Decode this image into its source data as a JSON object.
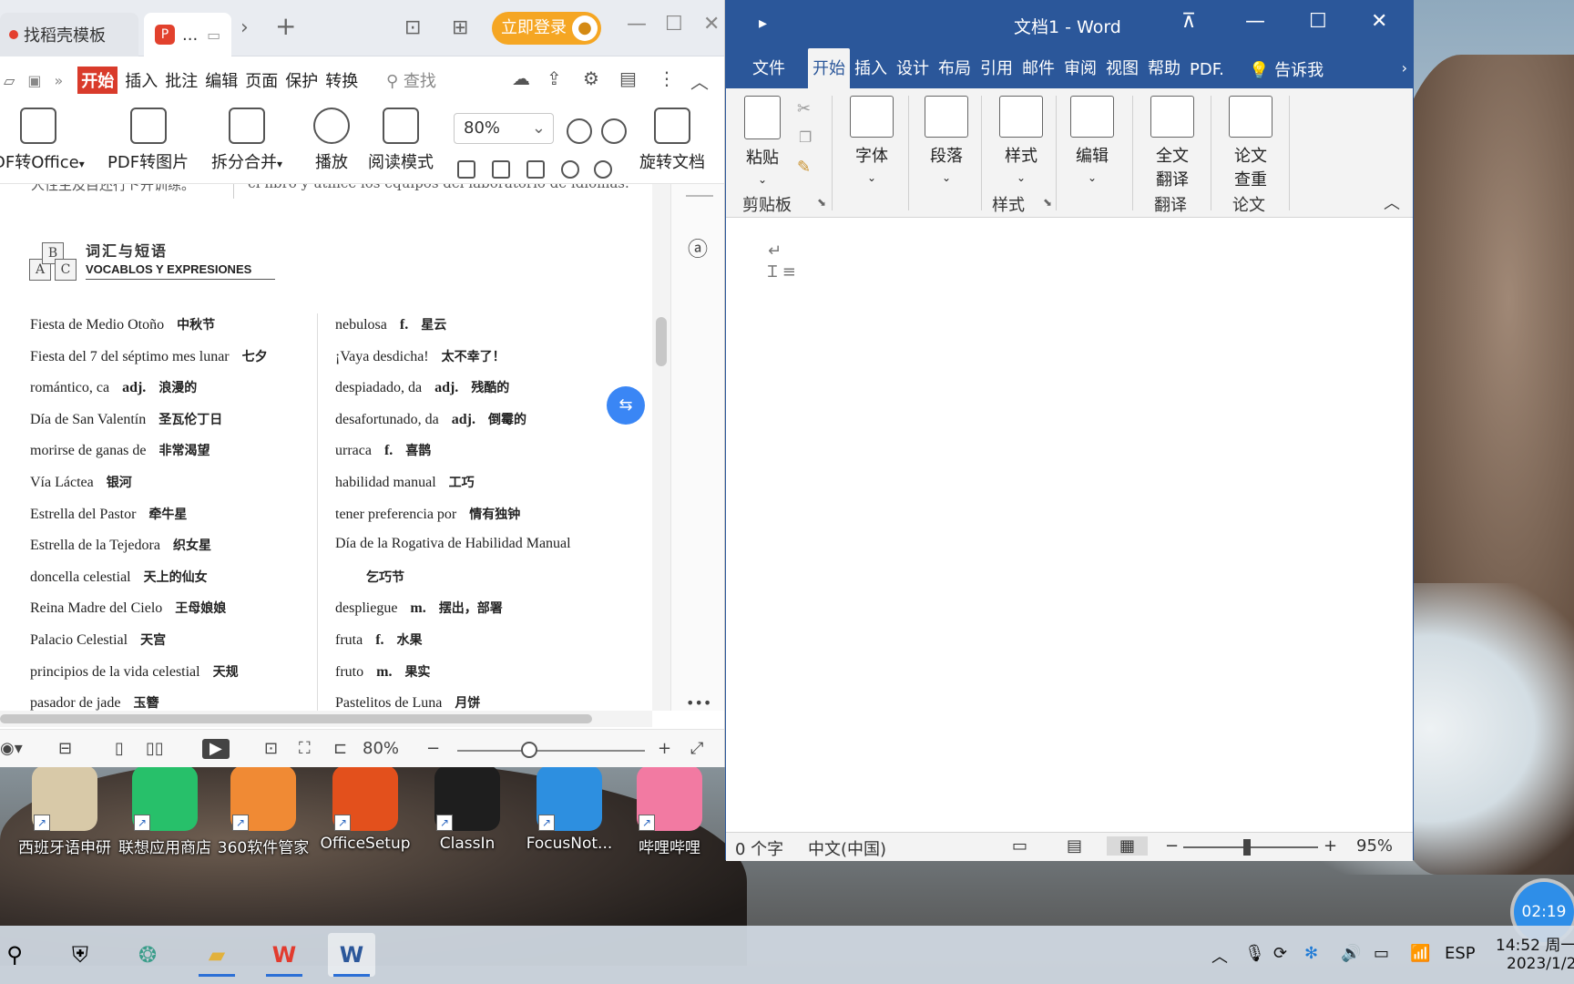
{
  "wps": {
    "tabs": [
      {
        "label": "找稻壳模板"
      },
      {
        "label": "..."
      }
    ],
    "login_label": "立即登录",
    "menu": {
      "active": "开始",
      "items": [
        "插入",
        "批注",
        "编辑",
        "页面",
        "保护",
        "转换"
      ],
      "search_placeholder": "查找"
    },
    "ribbon": {
      "pdf_to_office": "DF转Office",
      "pdf_to_image": "PDF转图片",
      "split_merge": "拆分合并",
      "play": "播放",
      "read_mode": "阅读模式",
      "zoom": "80%",
      "rotate": "旋转文档"
    },
    "page_top_text_left": "人性主及目还行ト开训练。",
    "page_top_text_right": "el libro y utilice los equipos del laboratorio de idiomas.",
    "vocab_title_cn": "词汇与短语",
    "vocab_title_es": "VOCABLOS Y EXPRESIONES",
    "logo_letters": [
      "A",
      "B",
      "C"
    ],
    "vocab_left": [
      {
        "es": "Fiesta de Medio Otoño",
        "pos": "",
        "zh": "中秋节"
      },
      {
        "es": "Fiesta del 7 del séptimo mes lunar",
        "pos": "",
        "zh": "七夕"
      },
      {
        "es": "romántico, ca",
        "pos": "adj.",
        "zh": "浪漫的"
      },
      {
        "es": "Día de San Valentín",
        "pos": "",
        "zh": "圣瓦伦丁日"
      },
      {
        "es": "morirse de ganas de",
        "pos": "",
        "zh": "非常渴望"
      },
      {
        "es": "Vía Láctea",
        "pos": "",
        "zh": "银河"
      },
      {
        "es": "Estrella del Pastor",
        "pos": "",
        "zh": "牵牛星"
      },
      {
        "es": "Estrella de la Tejedora",
        "pos": "",
        "zh": "织女星"
      },
      {
        "es": "doncella celestial",
        "pos": "",
        "zh": "天上的仙女"
      },
      {
        "es": "Reina Madre del Cielo",
        "pos": "",
        "zh": "王母娘娘"
      },
      {
        "es": "Palacio Celestial",
        "pos": "",
        "zh": "天宫"
      },
      {
        "es": "principios de la vida celestial",
        "pos": "",
        "zh": "天规"
      },
      {
        "es": "pasador de jade",
        "pos": "",
        "zh": "玉簪"
      }
    ],
    "vocab_right": [
      {
        "es": "nebulosa",
        "pos": "f.",
        "zh": "星云"
      },
      {
        "es": "¡Vaya desdicha!",
        "pos": "",
        "zh": "太不幸了！"
      },
      {
        "es": "despiadado, da",
        "pos": "adj.",
        "zh": "残酷的"
      },
      {
        "es": "desafortunado, da",
        "pos": "adj.",
        "zh": "倒霉的"
      },
      {
        "es": "urraca",
        "pos": "f.",
        "zh": "喜鹊"
      },
      {
        "es": "habilidad manual",
        "pos": "",
        "zh": "工巧"
      },
      {
        "es": "tener preferencia por",
        "pos": "",
        "zh": "情有独钟"
      },
      {
        "es": "Día de la Rogativa de Habilidad Manual",
        "pos": "",
        "zh": ""
      },
      {
        "es": "",
        "pos": "",
        "zh": "乞巧节"
      },
      {
        "es": "despliegue",
        "pos": "m.",
        "zh": "摆出，部署"
      },
      {
        "es": "fruta",
        "pos": "f.",
        "zh": "水果"
      },
      {
        "es": "fruto",
        "pos": "m.",
        "zh": "果实"
      },
      {
        "es": "Pastelitos de Luna",
        "pos": "",
        "zh": "月饼"
      }
    ],
    "status_zoom": "80%",
    "sidebar_more": "•••"
  },
  "word": {
    "title": "文档1  -  Word",
    "tabs": [
      "文件",
      "开始",
      "插入",
      "设计",
      "布局",
      "引用",
      "邮件",
      "审阅",
      "视图",
      "帮助",
      "PDF."
    ],
    "tell_me": "告诉我",
    "ribbon": {
      "paste": "粘贴",
      "font": "字体",
      "paragraph": "段落",
      "styles": "样式",
      "edit": "编辑",
      "full_translate": [
        "全文",
        "翻译"
      ],
      "thesis_check": [
        "论文",
        "查重"
      ],
      "group_clipboard": "剪贴板",
      "group_styles": "样式",
      "group_translate": "翻译",
      "group_thesis": "论文"
    },
    "status": {
      "word_count": "0 个字",
      "language": "中文(中国)",
      "zoom": "95%"
    }
  },
  "desktop_icons": [
    {
      "label": "西班牙语申研",
      "color": "#d8c9a8"
    },
    {
      "label": "联想应用商店",
      "color": "#27c06a"
    },
    {
      "label": "360软件管家",
      "color": "#f08a34"
    },
    {
      "label": "OfficeSetup",
      "color": "#e3501c"
    },
    {
      "label": "ClassIn",
      "color": "#1e1e1e"
    },
    {
      "label": "FocusNot...",
      "color": "#2d8fe0"
    },
    {
      "label": "哔哩哔哩",
      "color": "#f27aa2"
    }
  ],
  "timer": "02:19",
  "taskbar": {
    "language": "ESP",
    "time": "14:52 周一",
    "date": "2023/1/2"
  }
}
